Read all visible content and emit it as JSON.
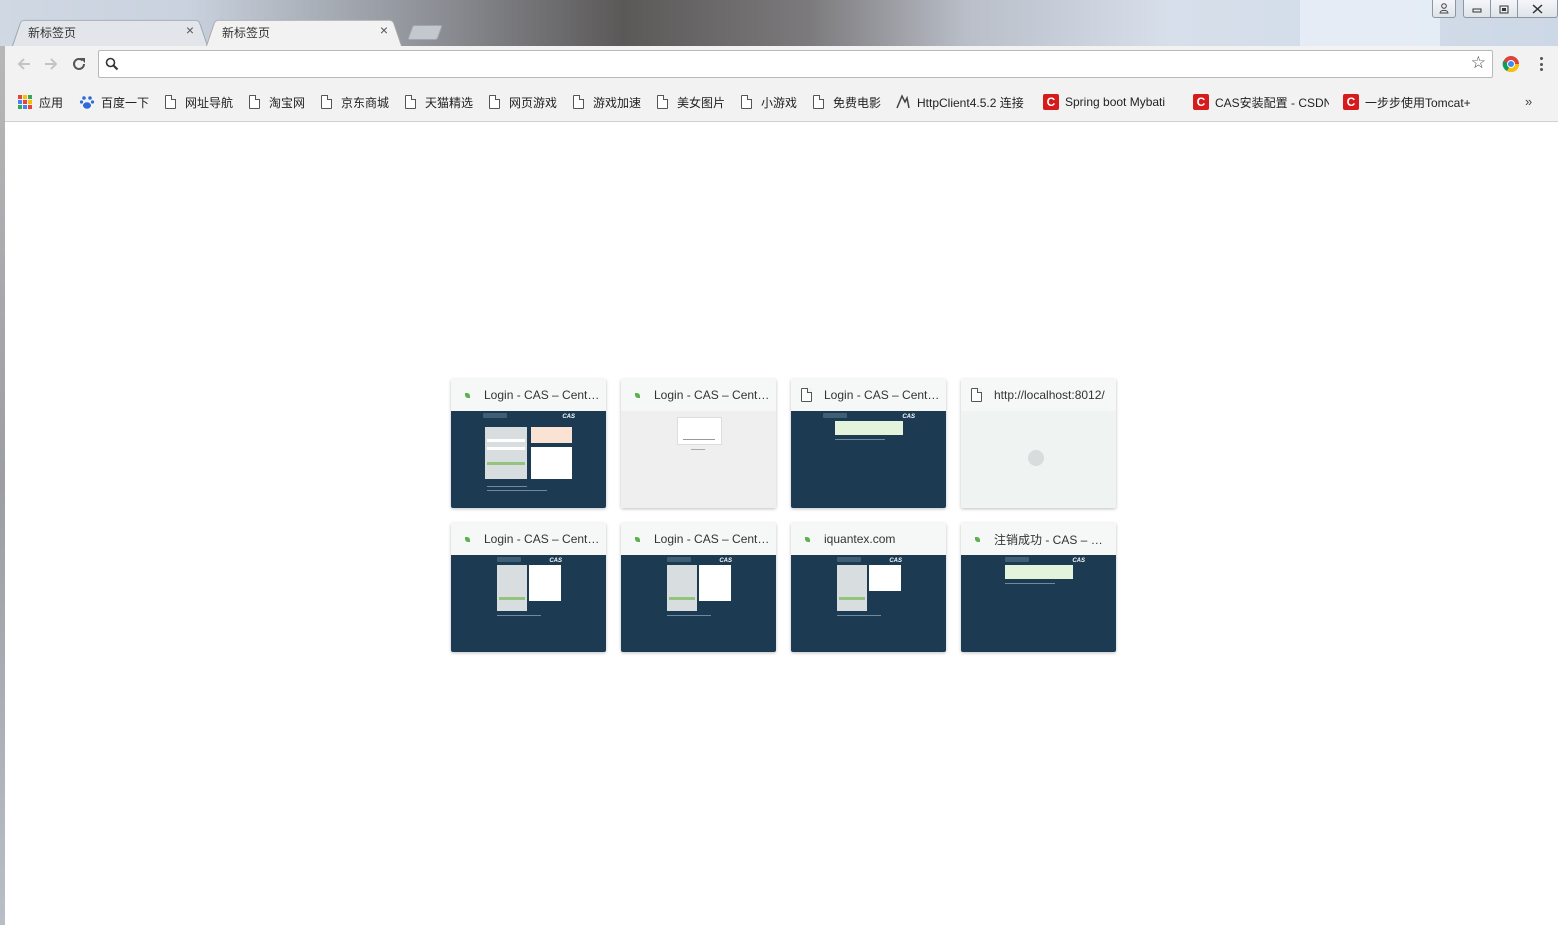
{
  "window": {
    "controls": [
      "profile",
      "minimize",
      "restore",
      "close"
    ]
  },
  "tabs": [
    {
      "label": "新标签页",
      "active": false,
      "close": "×"
    },
    {
      "label": "新标签页",
      "active": true,
      "close": "×"
    }
  ],
  "toolbar": {
    "back_icon": "arrow-left-icon",
    "forward_icon": "arrow-right-icon",
    "reload_icon": "reload-icon",
    "omnibox_value": "",
    "star_glyph": "☆"
  },
  "bookmarks": {
    "items": [
      {
        "label": "应用",
        "icon": "apps-grid-icon"
      },
      {
        "label": "百度一下",
        "icon": "baidu-paw-icon"
      },
      {
        "label": "网址导航",
        "icon": "page-icon"
      },
      {
        "label": "淘宝网",
        "icon": "page-icon"
      },
      {
        "label": "京东商城",
        "icon": "page-icon"
      },
      {
        "label": "天猫精选",
        "icon": "page-icon"
      },
      {
        "label": "网页游戏",
        "icon": "page-icon"
      },
      {
        "label": "游戏加速",
        "icon": "page-icon"
      },
      {
        "label": "美女图片",
        "icon": "page-icon"
      },
      {
        "label": "小游戏",
        "icon": "page-icon"
      },
      {
        "label": "免费电影",
        "icon": "page-icon"
      },
      {
        "label": "HttpClient4.5.2 连接",
        "icon": "httpclient-icon"
      },
      {
        "label": "Spring boot Mybati",
        "icon": "csdn-icon"
      },
      {
        "label": "CAS安装配置 - CSDN",
        "icon": "csdn-icon"
      },
      {
        "label": "一步步使用Tomcat+",
        "icon": "csdn-icon"
      }
    ],
    "overflow_glyph": "»"
  },
  "most_visited": [
    {
      "title": "Login - CAS – Central Authentication Service",
      "favicon": "leaf-icon",
      "thumb": "cas-login-full"
    },
    {
      "title": "Login - CAS – Central Authentication Service",
      "favicon": "leaf-icon",
      "thumb": "gray-login"
    },
    {
      "title": "Login - CAS – Central Authentication Service",
      "favicon": "page-icon",
      "thumb": "cas-success"
    },
    {
      "title": "http://localhost:8012/",
      "favicon": "page-icon",
      "thumb": "blank-loading"
    },
    {
      "title": "Login - CAS – Central Authentication Service",
      "favicon": "leaf-icon",
      "thumb": "cas-login-small"
    },
    {
      "title": "Login - CAS – Central Authentication Service",
      "favicon": "leaf-icon",
      "thumb": "cas-login-small"
    },
    {
      "title": "iquantex.com",
      "favicon": "leaf-icon",
      "thumb": "cas-login-small"
    },
    {
      "title": "注销成功 - CAS – Central Authentication Service",
      "favicon": "leaf-icon",
      "thumb": "cas-success"
    }
  ],
  "thumb_text": {
    "cas": "CAS"
  },
  "colors": {
    "cas_navy": "#1c3b52",
    "csdn_red": "#d51b1b",
    "tile_header": "#f6f8f8"
  }
}
